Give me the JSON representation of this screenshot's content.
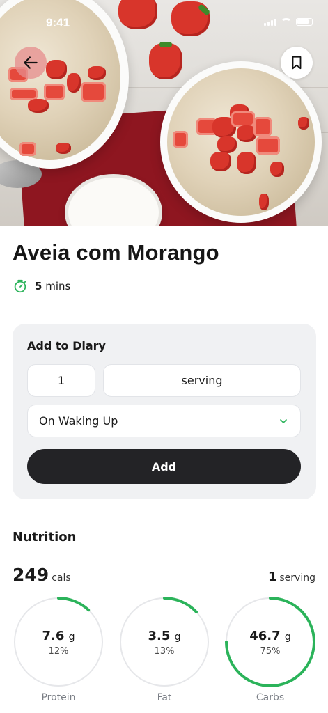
{
  "status_bar": {
    "time": "9:41"
  },
  "header": {
    "back_icon": "arrow-left-icon",
    "bookmark_icon": "bookmark-icon"
  },
  "recipe": {
    "title": "Aveia com Morango",
    "time_value": "5",
    "time_unit": "mins",
    "time_icon": "timer-icon"
  },
  "diary": {
    "title": "Add to Diary",
    "quantity": "1",
    "unit": "serving",
    "meal": "On Waking Up",
    "add_label": "Add"
  },
  "nutrition": {
    "title": "Nutrition",
    "calories": "249",
    "calories_unit": "cals",
    "servings": "1",
    "servings_unit": "serving",
    "accent": "#2bb35a",
    "macros": [
      {
        "label": "Protein",
        "value": "7.6",
        "unit": "g",
        "percent_label": "12%",
        "fraction": 0.12
      },
      {
        "label": "Fat",
        "value": "3.5",
        "unit": "g",
        "percent_label": "13%",
        "fraction": 0.13
      },
      {
        "label": "Carbs",
        "value": "46.7",
        "unit": "g",
        "percent_label": "75%",
        "fraction": 0.75
      }
    ]
  }
}
